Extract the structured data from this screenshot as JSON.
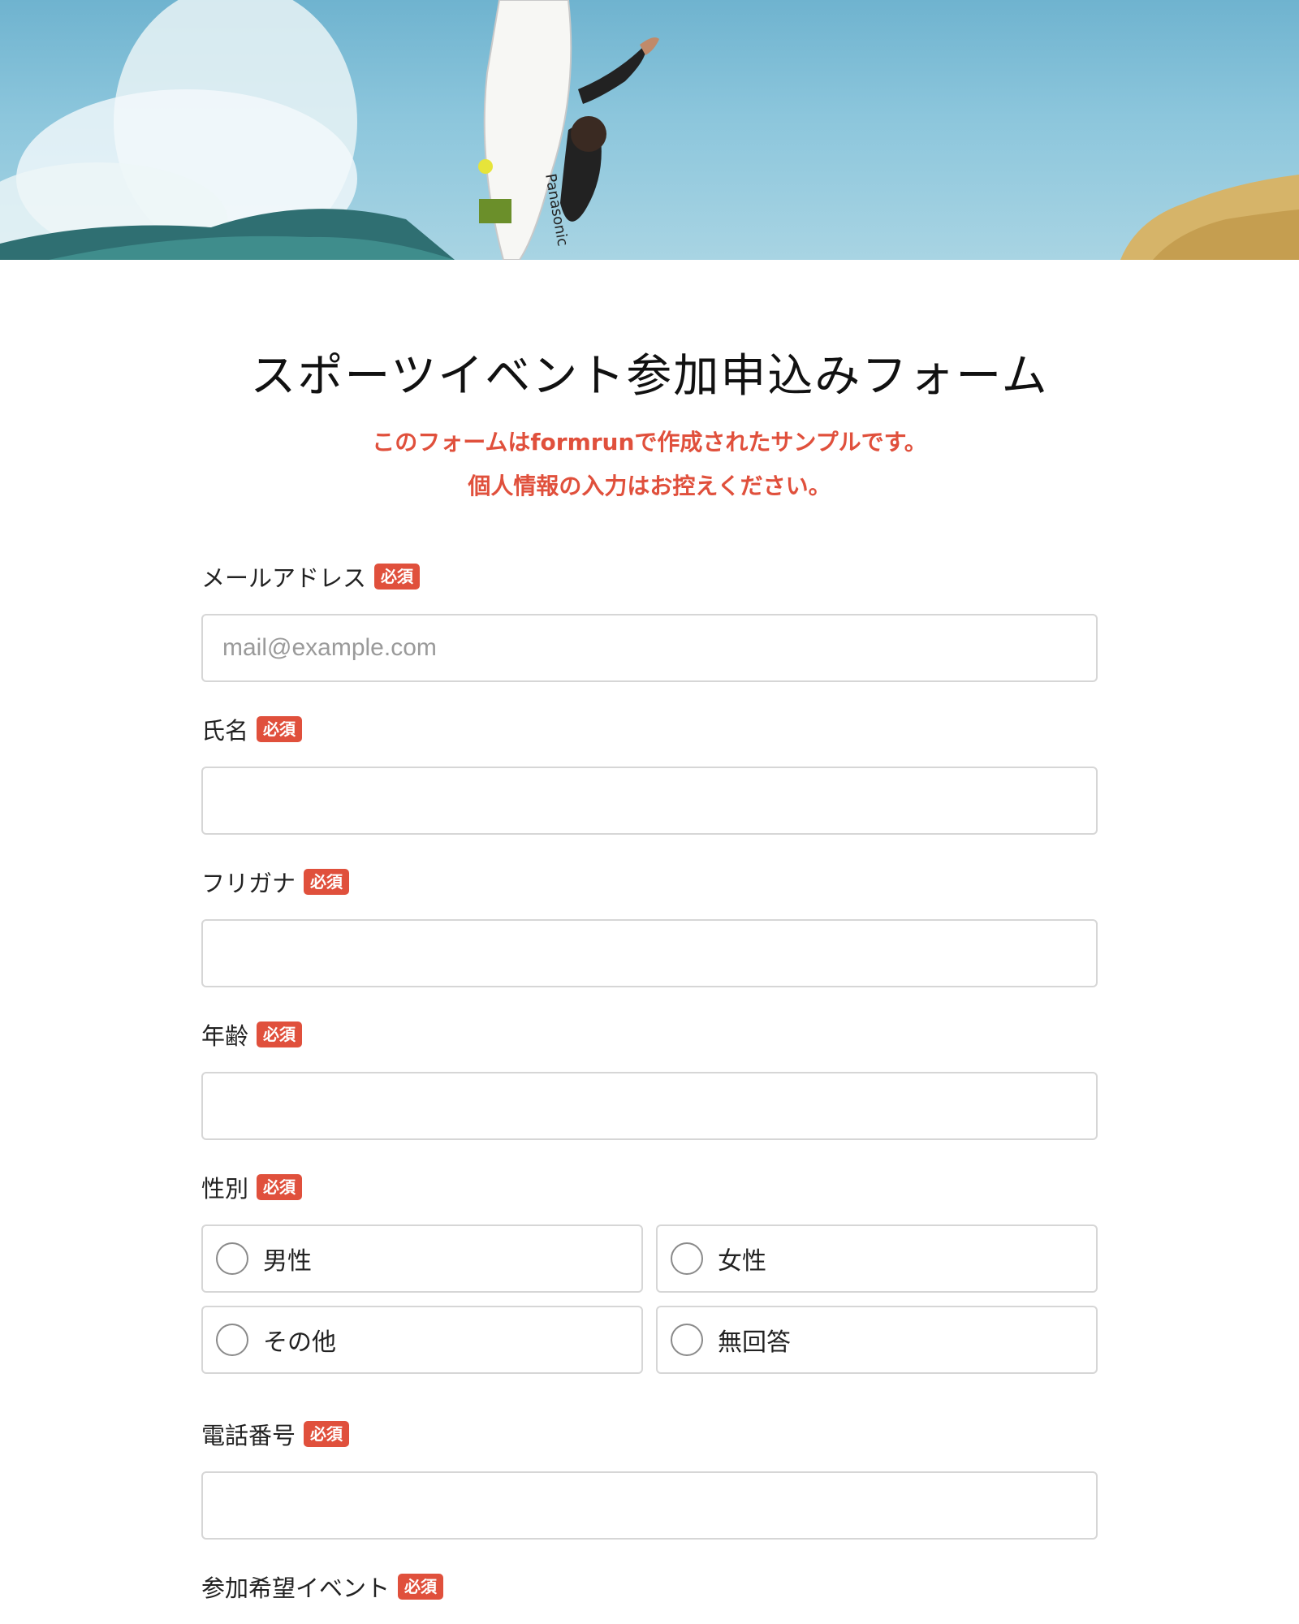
{
  "form": {
    "title": "スポーツイベント参加申込みフォーム",
    "notice_line1": "このフォームはformrunで作成されたサンプルです。",
    "notice_line2": "個人情報の入力はお控えください。",
    "required_badge": "必須"
  },
  "fields": {
    "email": {
      "label": "メールアドレス",
      "placeholder": "mail@example.com",
      "value": ""
    },
    "name": {
      "label": "氏名",
      "value": ""
    },
    "furigana": {
      "label": "フリガナ",
      "value": ""
    },
    "age": {
      "label": "年齢",
      "value": ""
    },
    "gender": {
      "label": "性別",
      "options": [
        "男性",
        "女性",
        "その他",
        "無回答"
      ]
    },
    "phone": {
      "label": "電話番号",
      "value": ""
    },
    "event": {
      "label": "参加希望イベント"
    }
  },
  "hero": {
    "board_text": "Panasonic"
  },
  "colors": {
    "accent": "#e0503c",
    "border": "#d6d6d6",
    "sky": "#8cc6dc"
  }
}
